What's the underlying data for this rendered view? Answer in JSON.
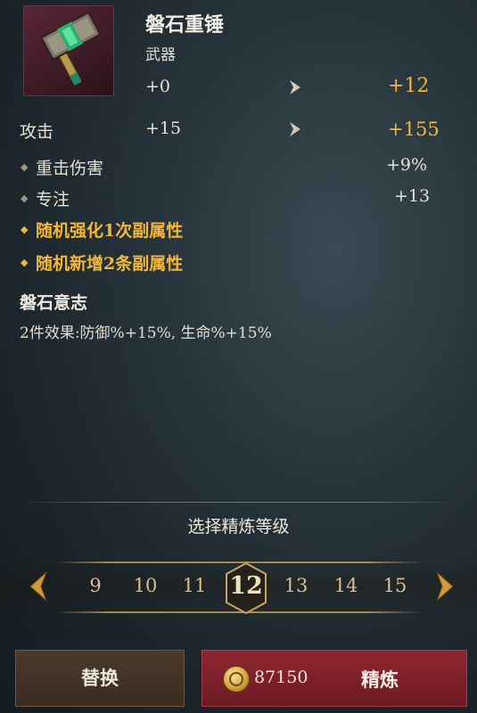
{
  "item": {
    "name": "磐石重锤",
    "type": "武器",
    "level_from": "+0",
    "level_to": "+12"
  },
  "stats": {
    "main": {
      "label": "攻击",
      "from": "+15",
      "to": "+155"
    },
    "subs": [
      {
        "label": "重击伤害",
        "value": "+9%"
      },
      {
        "label": "专注",
        "value": "+13"
      }
    ],
    "bonuses": [
      "随机强化1次副属性",
      "随机新增2条副属性"
    ]
  },
  "set": {
    "title": "磐石意志",
    "desc": "2件效果:防御%+15%, 生命%+15%"
  },
  "refine": {
    "title": "选择精炼等级",
    "levels": [
      "9",
      "10",
      "11",
      "12",
      "13",
      "14",
      "15"
    ],
    "selected": "12"
  },
  "buttons": {
    "replace": "替换",
    "refine": "精炼",
    "gold": "87150"
  },
  "colors": {
    "accent_gold": "#f2b63a",
    "refine_button": "#8e2630"
  }
}
